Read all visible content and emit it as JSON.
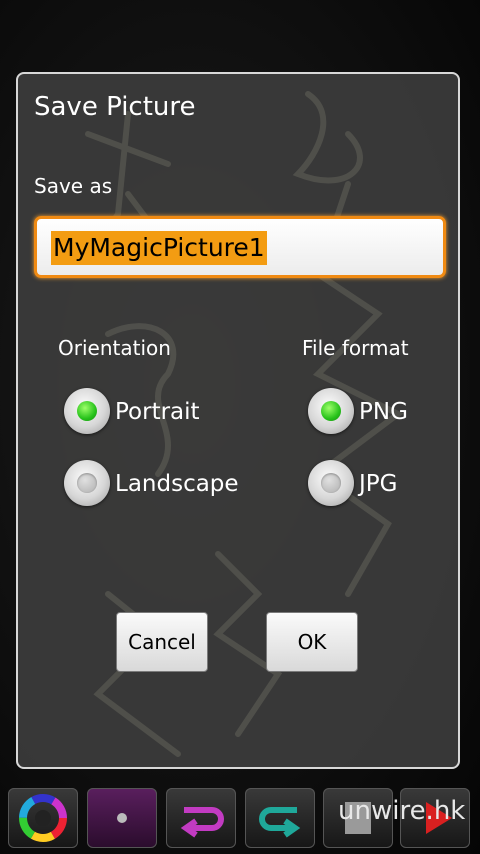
{
  "dialog": {
    "title": "Save Picture",
    "save_as_label": "Save as",
    "filename_value": "MyMagicPicture1"
  },
  "orientation": {
    "label": "Orientation",
    "options": [
      {
        "label": "Portrait",
        "selected": true
      },
      {
        "label": "Landscape",
        "selected": false
      }
    ]
  },
  "file_format": {
    "label": "File format",
    "options": [
      {
        "label": "PNG",
        "selected": true
      },
      {
        "label": "JPG",
        "selected": false
      }
    ]
  },
  "buttons": {
    "cancel": "Cancel",
    "ok": "OK"
  },
  "toolbar": {
    "tools": [
      "color-wheel-icon",
      "brush-size-icon",
      "redo-icon",
      "undo-icon",
      "clear-icon",
      "play-icon"
    ]
  },
  "watermark": "unwire.hk",
  "colors": {
    "accent_orange": "#f08a12",
    "selection": "#f39c12",
    "radio_selected": "#27c21b"
  }
}
